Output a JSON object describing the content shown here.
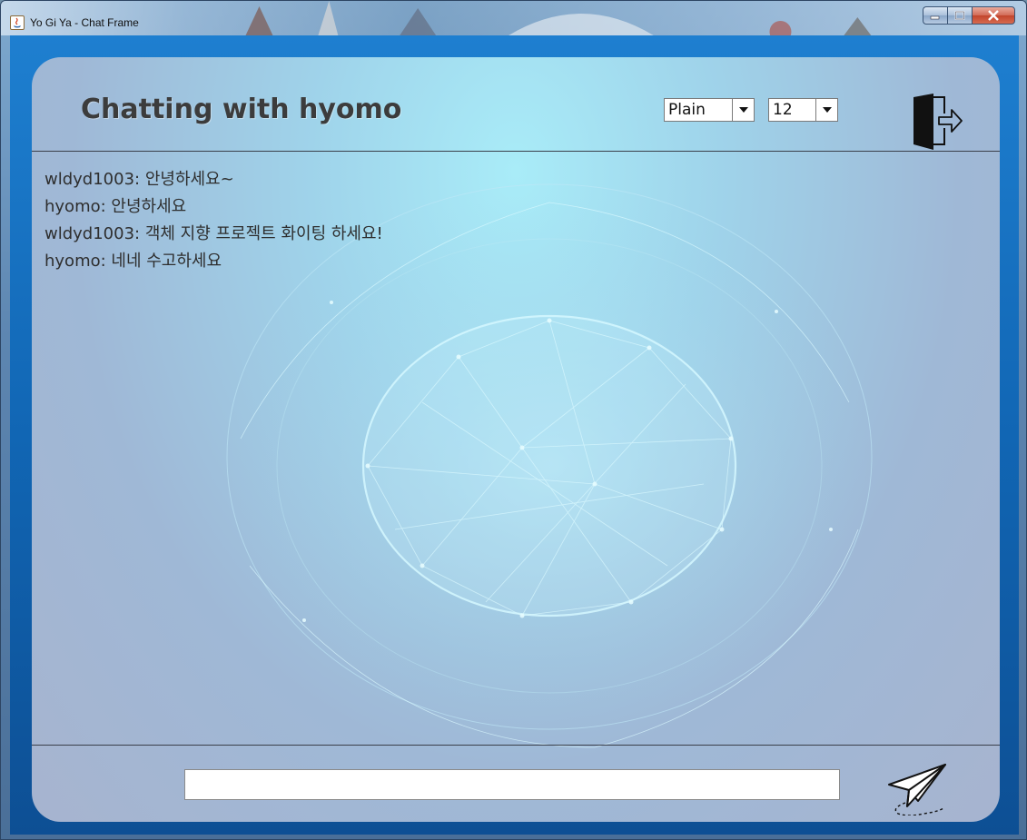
{
  "window": {
    "title": "Yo Gi Ya - Chat Frame",
    "app_icon": "java-icon",
    "controls": [
      "minimize-icon",
      "maximize-icon",
      "close-icon"
    ]
  },
  "header": {
    "title": "Chatting with hyomo",
    "font_style_select": {
      "value": "Plain"
    },
    "font_size_select": {
      "value": "12"
    },
    "exit_icon": "exit-door-icon"
  },
  "messages": [
    {
      "text": "wldyd1003: 안녕하세요~"
    },
    {
      "text": "hyomo: 안녕하세요"
    },
    {
      "text": "wldyd1003: 객체 지향 프로젝트 화이팅 하세요!"
    },
    {
      "text": "hyomo: 네네 수고하세요"
    }
  ],
  "composer": {
    "input_value": "",
    "send_icon": "paper-plane-icon"
  },
  "colors": {
    "frame_blue": "#1166b4",
    "panel_cyan": "#a9ecf8",
    "title_text": "#3c3c3c"
  }
}
